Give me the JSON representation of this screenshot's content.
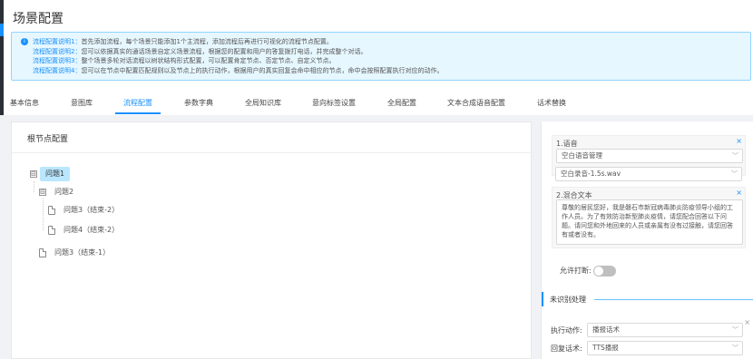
{
  "page": {
    "title": "场景配置"
  },
  "notice": {
    "lines": [
      {
        "key": "流程配置说明1：",
        "text": "首先添加流程，每个场景只能添加1个主流程，添加流程后再进行可视化的流程节点配置。"
      },
      {
        "key": "流程配置说明2：",
        "text": "您可以依据真实的通话场景自定义场景流程，根据您的配置和用户的答复拨打电话，并完成整个对话。"
      },
      {
        "key": "流程配置说明3：",
        "text": "整个场景多轮对话流程以树状结构形式配置，可以配置肯定节点、否定节点、自定义节点。"
      },
      {
        "key": "流程配置说明4：",
        "text": "您可以在节点中配置匹配规则以及节点上的执行动作，根据用户的真实回复会命中相应的节点，命中会按照配置执行对应的动作。"
      }
    ]
  },
  "tabs": [
    "基本信息",
    "意图库",
    "流程配置",
    "参数字典",
    "全局知识库",
    "意向标签设置",
    "全局配置",
    "文本合成语音配置",
    "话术替换"
  ],
  "active_tab": "流程配置",
  "tree": {
    "title": "根节点配置",
    "nodes": [
      {
        "label": "问题1",
        "toggle": "⊟"
      },
      {
        "label": "问题2",
        "toggle": "⊟"
      },
      {
        "label": "问题3（结束-2）"
      },
      {
        "label": "问题4（结束-2）"
      },
      {
        "label": "问题3（结束-1）"
      }
    ]
  },
  "config": {
    "voice_card": {
      "label": "1.语音",
      "close": "×",
      "select1": "空白语音管理",
      "select2": "空白录音-1.5s.wav"
    },
    "text_card": {
      "label": "2.混合文本",
      "close": "×",
      "content": "尊敬的居民您好，我是磐石市新冠病毒肺炎防疫领导小组的工作人员。为了有效防治新型肺炎疫情，请您配合回答以下问题。请问您和外地回来的人员或亲属有没有过接触，请您回答有或者没有。"
    },
    "interrupt": {
      "label": "允许打断:",
      "enabled": false
    },
    "unrecognized": {
      "title": "未识别处理",
      "close": "×",
      "action_label": "执行动作:",
      "action_value": "播报话术",
      "reply_label": "回复话术:",
      "reply_value": "TTS播报"
    }
  },
  "icons": {
    "info": "info-icon",
    "chevron": "chevron-down-icon",
    "file": "file-icon"
  },
  "colors": {
    "accent": "#1890ff",
    "notice_bg": "#e6f7ff",
    "selected_node": "#bae7ff"
  }
}
